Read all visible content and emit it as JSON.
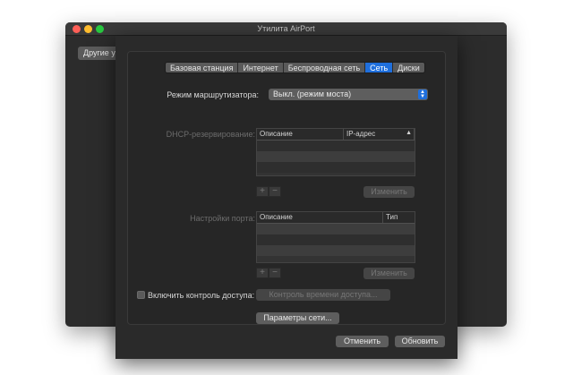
{
  "window": {
    "title": "Утилита AirPort",
    "toolbar_button": "Другие у"
  },
  "tabs": [
    {
      "label": "Базовая станция",
      "active": false
    },
    {
      "label": "Интернет",
      "active": false
    },
    {
      "label": "Беспроводная сеть",
      "active": false
    },
    {
      "label": "Сеть",
      "active": true
    },
    {
      "label": "Диски",
      "active": false
    }
  ],
  "router_mode": {
    "label": "Режим маршрутизатора:",
    "value": "Выкл. (режим моста)"
  },
  "dhcp": {
    "label": "DHCP-резервирование:",
    "columns": [
      "Описание",
      "IP-адрес"
    ],
    "add": "+",
    "remove": "−",
    "edit": "Изменить"
  },
  "ports": {
    "label": "Настройки порта:",
    "columns": [
      "Описание",
      "Тип"
    ],
    "add": "+",
    "remove": "−",
    "edit": "Изменить"
  },
  "access": {
    "label": "Включить контроль доступа:",
    "checked": false,
    "button": "Контроль времени доступа..."
  },
  "network_options_button": "Параметры сети...",
  "footer": {
    "cancel": "Отменить",
    "update": "Обновить"
  },
  "colors": {
    "accent": "#1f6fdc",
    "close": "#fe5f57",
    "minimize": "#febc2e",
    "zoom": "#28c840"
  },
  "icons": {
    "popup": "updown-chevron-icon",
    "sort": "sort-ascending-icon"
  }
}
